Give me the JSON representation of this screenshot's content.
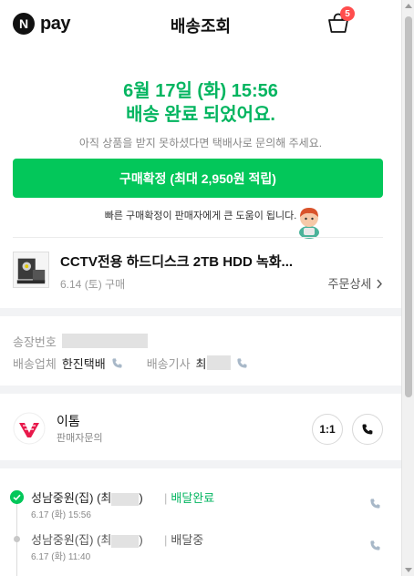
{
  "header": {
    "logo_letter": "N",
    "logo_text": "pay",
    "title": "배송조회",
    "cart_count": "5"
  },
  "status": {
    "date": "6월 17일 (화) 15:56",
    "message": "배송 완료 되었어요.",
    "sub": "아직 상품을 받지 못하셨다면 택배사로 문의해 주세요."
  },
  "confirm": {
    "label": "구매확정 (최대 2,950원 적립)",
    "tip": "빠른 구매확정이 판매자에게 큰 도움이 됩니다."
  },
  "product": {
    "name": "CCTV전용 하드디스크 2TB HDD 녹화...",
    "order_date": "6.14 (토) 구매",
    "detail_label": "주문상세"
  },
  "shipping": {
    "tracking_label": "송장번호",
    "carrier_label": "배송업체",
    "carrier_value": "한진택배",
    "driver_label": "배송기사",
    "driver_value": "최"
  },
  "seller": {
    "name": "이톰",
    "sub": "판매자문의",
    "chat_label": "1:1"
  },
  "timeline": [
    {
      "place": "성남중원(집) (최",
      "place_suffix": ")",
      "time": "6.17 (화) 15:56",
      "status": "배달완료"
    },
    {
      "place": "성남중원(집) (최",
      "place_suffix": ")",
      "time": "6.17 (화) 11:40",
      "status": "배달중"
    }
  ],
  "colors": {
    "accent_green": "#03c75a",
    "status_green": "#03b560",
    "cart_badge": "#ff4d4d"
  }
}
